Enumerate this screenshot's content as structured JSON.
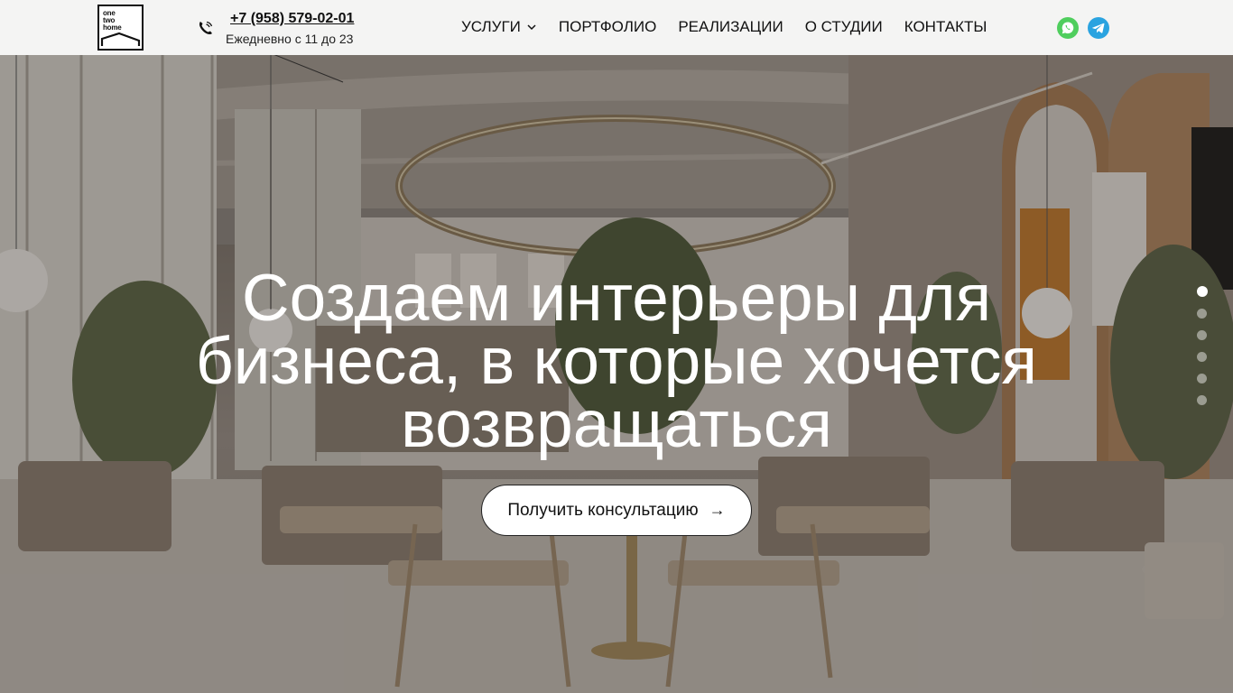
{
  "brand": {
    "logo_lines": [
      "one",
      "two",
      "home"
    ]
  },
  "contact": {
    "phone": "+7 (958) 579-02-01",
    "hours": "Ежедневно с 11 до 23"
  },
  "nav": {
    "items": [
      {
        "label": "УСЛУГИ",
        "has_dropdown": true
      },
      {
        "label": "ПОРТФОЛИО"
      },
      {
        "label": "РЕАЛИЗАЦИИ"
      },
      {
        "label": "О СТУДИИ"
      },
      {
        "label": "КОНТАКТЫ"
      }
    ]
  },
  "social": {
    "whatsapp": {
      "icon": "whatsapp-icon",
      "color": "#4fce5d"
    },
    "telegram": {
      "icon": "telegram-icon",
      "color": "#2aa3e0"
    }
  },
  "hero": {
    "title_lines": [
      "Создаем интерьеры для",
      "бизнеса, в которые хочется",
      "возвращаться"
    ],
    "cta_label": "Получить консультацию",
    "cta_arrow": "→",
    "slides_count": 6,
    "active_slide": 1
  },
  "colors": {
    "header_bg": "#f4f4f3",
    "text": "#111111",
    "accent_white": "#ffffff"
  }
}
